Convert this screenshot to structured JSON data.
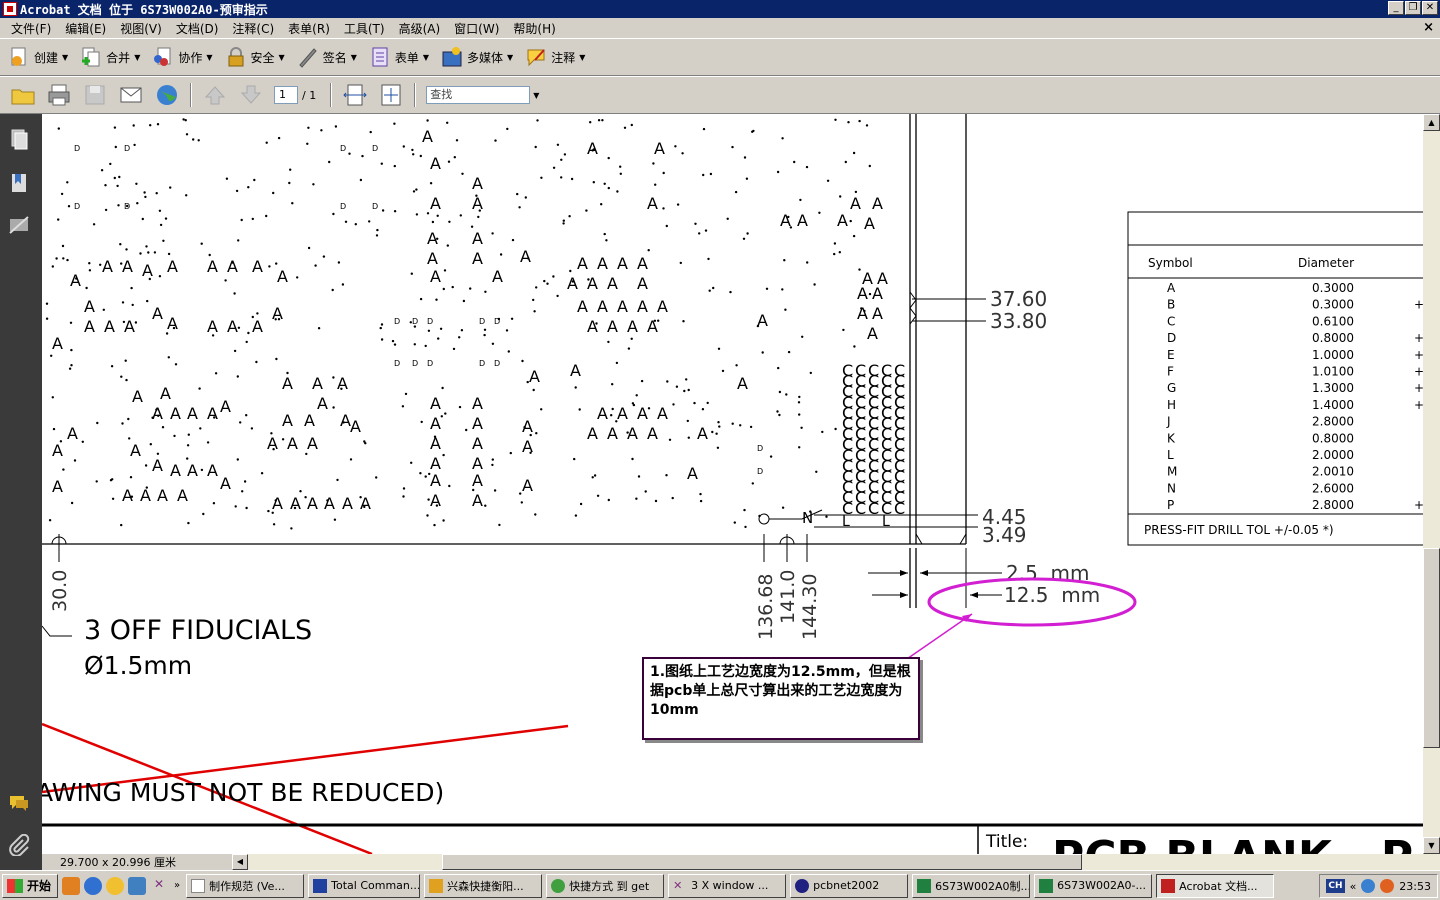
{
  "window": {
    "title": "Acrobat 文档 位于 6S73W002A0-预审指示"
  },
  "menubar": {
    "items": [
      "文件(F)",
      "编辑(E)",
      "视图(V)",
      "文档(D)",
      "注释(C)",
      "表单(R)",
      "工具(T)",
      "高级(A)",
      "窗口(W)",
      "帮助(H)"
    ]
  },
  "toolbar1": {
    "items": [
      {
        "label": "创建",
        "icon": "create-icon"
      },
      {
        "label": "合并",
        "icon": "combine-icon"
      },
      {
        "label": "协作",
        "icon": "collaborate-icon"
      },
      {
        "label": "安全",
        "icon": "lock-icon"
      },
      {
        "label": "签名",
        "icon": "pen-icon"
      },
      {
        "label": "表单",
        "icon": "form-icon"
      },
      {
        "label": "多媒体",
        "icon": "multimedia-icon"
      },
      {
        "label": "注释",
        "icon": "comment-icon"
      }
    ]
  },
  "toolbar2": {
    "page_current": "1",
    "page_total": "/ 1",
    "find_placeholder": "查找"
  },
  "drawing": {
    "dims_right": [
      "37.60",
      "33.80",
      "4.45",
      "3.49"
    ],
    "dims_bottom": [
      "2.5  mm",
      "12.5  mm"
    ],
    "dims_vertical": [
      "136.68",
      "141.0",
      "144.30",
      "30.0"
    ],
    "fiducials_line1": "3 OFF FIDUCIALS",
    "fiducials_line2": "Ø1.5mm",
    "reduced_note": "AWING MUST NOT BE REDUCED)",
    "title_label": "Title:",
    "big_title": "PCB BLANK - P",
    "drill_table": {
      "header_symbol": "Symbol",
      "header_diameter": "Diameter",
      "rows": [
        {
          "sym": "A",
          "dia": "0.3000",
          "plus": ""
        },
        {
          "sym": "B",
          "dia": "0.3000",
          "plus": "+"
        },
        {
          "sym": "C",
          "dia": "0.6100",
          "plus": ""
        },
        {
          "sym": "D",
          "dia": "0.8000",
          "plus": "+"
        },
        {
          "sym": "E",
          "dia": "1.0000",
          "plus": "+"
        },
        {
          "sym": "F",
          "dia": "1.0100",
          "plus": "+"
        },
        {
          "sym": "G",
          "dia": "1.3000",
          "plus": "+"
        },
        {
          "sym": "H",
          "dia": "1.4000",
          "plus": "+"
        },
        {
          "sym": "J",
          "dia": "2.8000",
          "plus": ""
        },
        {
          "sym": "K",
          "dia": "0.8000",
          "plus": ""
        },
        {
          "sym": "L",
          "dia": "2.0000",
          "plus": ""
        },
        {
          "sym": "M",
          "dia": "2.0010",
          "plus": ""
        },
        {
          "sym": "N",
          "dia": "2.6000",
          "plus": ""
        },
        {
          "sym": "P",
          "dia": "2.8000",
          "plus": "+"
        }
      ],
      "footer": "PRESS-FIT DRILL TOL +/-0.05 *)"
    }
  },
  "callout": {
    "text": "1.图纸上工艺边宽度为12.5mm，但是根据pcb单上总尺寸算出来的工艺边宽度为10mm"
  },
  "statusbar": {
    "page_size": "29.700 x 20.996 厘米"
  },
  "taskbar": {
    "start": "开始",
    "buttons": [
      "制作规范 (Ve...",
      "Total Comman...",
      "兴森快捷衡阳...",
      "快捷方式 到 get",
      "3 X window ...",
      "pcbnet2002",
      "6S73W002A0制...",
      "6S73W002A0-...",
      "Acrobat 文档..."
    ],
    "ime": "CH",
    "clock": "23:53"
  },
  "colors": {
    "callout_border": "#3a003a",
    "ellipse": "#d21fd2",
    "red_lines": "#e00000",
    "titlebar": "#0a246a"
  }
}
